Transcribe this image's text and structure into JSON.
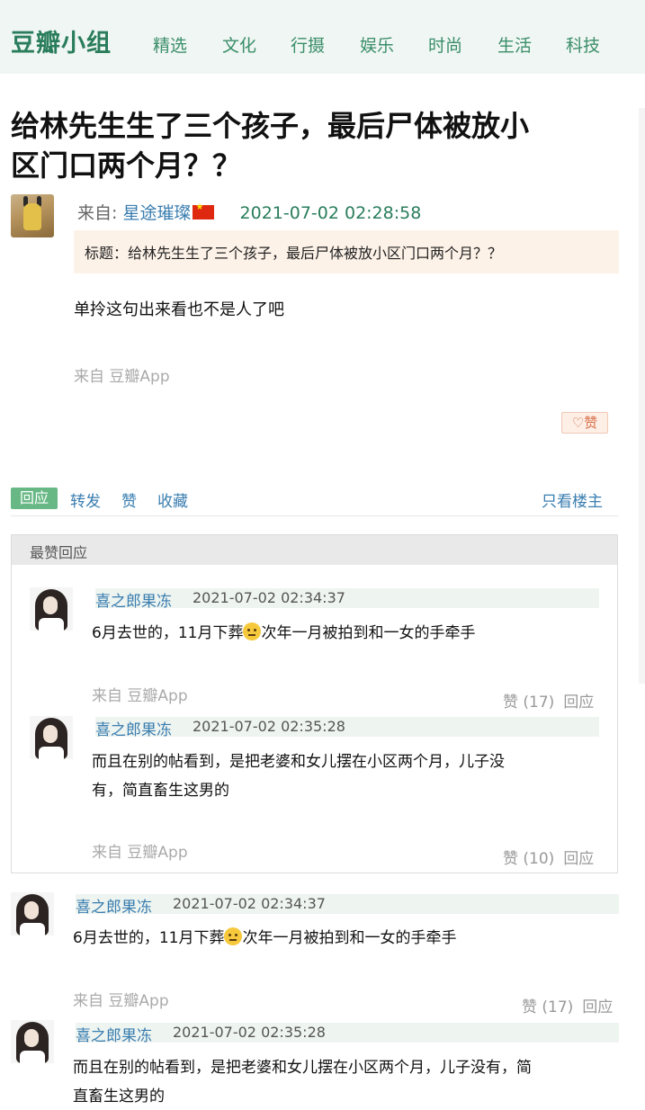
{
  "header": {
    "logo": "豆瓣小组",
    "nav": [
      "精选",
      "文化",
      "行摄",
      "娱乐",
      "时尚",
      "生活",
      "科技"
    ]
  },
  "topic": {
    "title_line1": "给林先生生了三个孩子，最后尸体被放小",
    "title_line2": "区门口两个月？？",
    "from_label": "来自:",
    "author": "星途璀璨",
    "date": "2021-07-02 02:28:58",
    "quote": "标题：给林先生生了三个孩子，最后尸体被放小区门口两个月？？",
    "content": "单拎这句出来看也不是人了吧",
    "via": "来自 豆瓣App",
    "like_label": "赞"
  },
  "actions": {
    "reply": "回应",
    "forward": "转发",
    "like": "赞",
    "collect": "收藏",
    "only_op": "只看楼主"
  },
  "top_replies": {
    "heading": "最赞回应",
    "items": [
      {
        "author": "喜之郎果冻",
        "time": "2021-07-02 02:34:37",
        "text_a": "6月去世的，11月下葬",
        "text_b": "次年一月被拍到和一女的手牵手",
        "via": "来自 豆瓣App",
        "votes": "赞 (17)",
        "reply": "回应"
      },
      {
        "author": "喜之郎果冻",
        "time": "2021-07-02 02:35:28",
        "line1": "而且在别的帖看到，是把老婆和女儿摆在小区两个月，儿子没",
        "line2": "有，简直畜生这男的",
        "via": "来自 豆瓣App",
        "votes": "赞 (10)",
        "reply": "回应"
      }
    ]
  },
  "replies": [
    {
      "author": "喜之郎果冻",
      "time": "2021-07-02 02:34:37",
      "text_a": "6月去世的，11月下葬",
      "text_b": "次年一月被拍到和一女的手牵手",
      "via": "来自 豆瓣App",
      "votes": "赞 (17)",
      "reply": "回应"
    },
    {
      "author": "喜之郎果冻",
      "time": "2021-07-02 02:35:28",
      "line1": "而且在别的帖看到，是把老婆和女儿摆在小区两个月，儿子没有，简",
      "line2": "直畜生这男的"
    }
  ],
  "colors": {
    "brand": "#2a7d5c",
    "link": "#3a7eb0",
    "header_bg": "#f0f6f3",
    "reply_button": "#68b886"
  }
}
